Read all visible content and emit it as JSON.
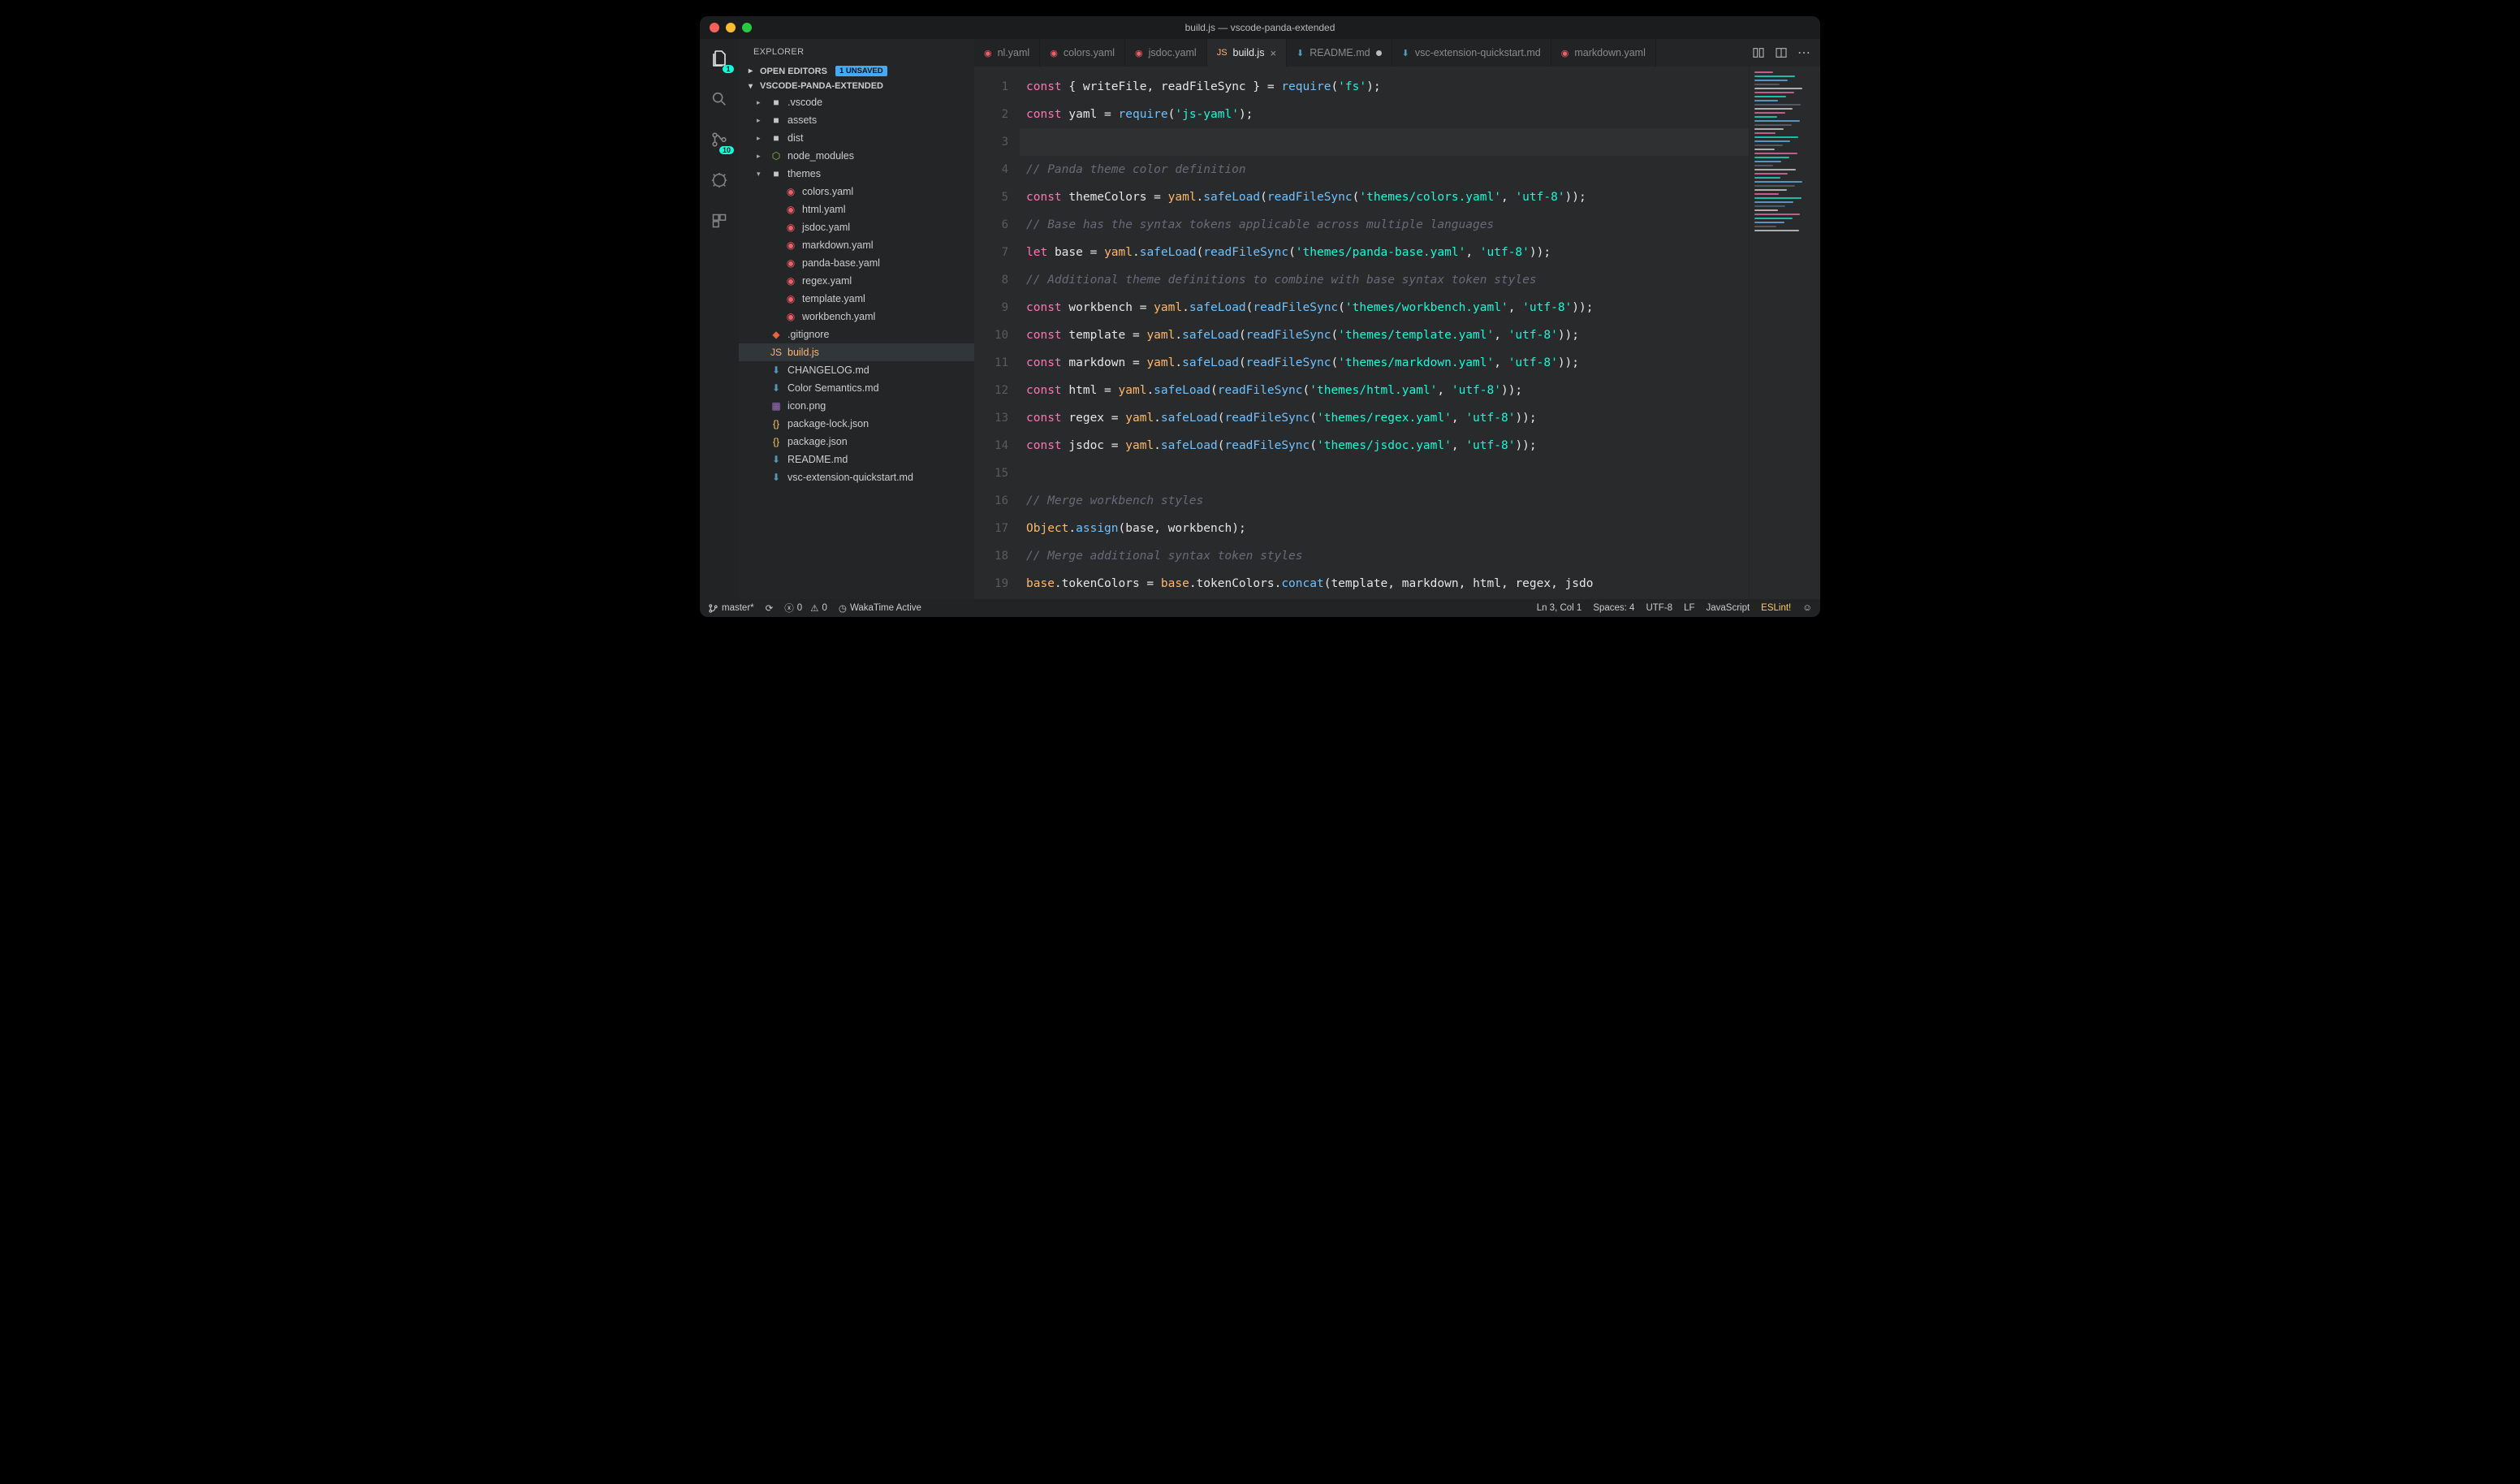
{
  "title": "build.js — vscode-panda-extended",
  "sidebar": {
    "title": "EXPLORER",
    "openEditors": {
      "label": "OPEN EDITORS",
      "badge": "1 UNSAVED"
    },
    "project": "VSCODE-PANDA-EXTENDED",
    "tree": [
      {
        "type": "folder",
        "name": ".vscode",
        "icon": "folder",
        "depth": 1,
        "expanded": false
      },
      {
        "type": "folder",
        "name": "assets",
        "icon": "folder",
        "depth": 1,
        "expanded": false
      },
      {
        "type": "folder",
        "name": "dist",
        "icon": "folder",
        "depth": 1,
        "expanded": false
      },
      {
        "type": "folder",
        "name": "node_modules",
        "icon": "node",
        "depth": 1,
        "expanded": false
      },
      {
        "type": "folder",
        "name": "themes",
        "icon": "folder",
        "depth": 1,
        "expanded": true
      },
      {
        "type": "file",
        "name": "colors.yaml",
        "icon": "y",
        "depth": 2
      },
      {
        "type": "file",
        "name": "html.yaml",
        "icon": "y",
        "depth": 2
      },
      {
        "type": "file",
        "name": "jsdoc.yaml",
        "icon": "y",
        "depth": 2
      },
      {
        "type": "file",
        "name": "markdown.yaml",
        "icon": "y",
        "depth": 2
      },
      {
        "type": "file",
        "name": "panda-base.yaml",
        "icon": "y",
        "depth": 2
      },
      {
        "type": "file",
        "name": "regex.yaml",
        "icon": "y",
        "depth": 2
      },
      {
        "type": "file",
        "name": "template.yaml",
        "icon": "y",
        "depth": 2
      },
      {
        "type": "file",
        "name": "workbench.yaml",
        "icon": "y",
        "depth": 2
      },
      {
        "type": "file",
        "name": ".gitignore",
        "icon": "git",
        "depth": 1
      },
      {
        "type": "file",
        "name": "build.js",
        "icon": "js",
        "depth": 1,
        "selected": true
      },
      {
        "type": "file",
        "name": "CHANGELOG.md",
        "icon": "md",
        "depth": 1
      },
      {
        "type": "file",
        "name": "Color Semantics.md",
        "icon": "md",
        "depth": 1
      },
      {
        "type": "file",
        "name": "icon.png",
        "icon": "img",
        "depth": 1
      },
      {
        "type": "file",
        "name": "package-lock.json",
        "icon": "json",
        "depth": 1
      },
      {
        "type": "file",
        "name": "package.json",
        "icon": "json",
        "depth": 1
      },
      {
        "type": "file",
        "name": "README.md",
        "icon": "md",
        "depth": 1
      },
      {
        "type": "file",
        "name": "vsc-extension-quickstart.md",
        "icon": "md",
        "depth": 1
      }
    ]
  },
  "activityBadges": {
    "explorer": "1",
    "scm": "10"
  },
  "tabs": [
    {
      "label": "nl.yaml",
      "icon": "y",
      "active": false
    },
    {
      "label": "colors.yaml",
      "icon": "y",
      "active": false
    },
    {
      "label": "jsdoc.yaml",
      "icon": "y",
      "active": false
    },
    {
      "label": "build.js",
      "icon": "js",
      "active": true,
      "close": true
    },
    {
      "label": "README.md",
      "icon": "md",
      "active": false,
      "dirty": true
    },
    {
      "label": "vsc-extension-quickstart.md",
      "icon": "md",
      "active": false
    },
    {
      "label": "markdown.yaml",
      "icon": "y",
      "active": false
    }
  ],
  "code": {
    "lines": [
      {
        "n": 1,
        "tokens": [
          [
            "kw",
            "const"
          ],
          [
            "punc",
            " { "
          ],
          [
            "var",
            "writeFile"
          ],
          [
            "punc",
            ", "
          ],
          [
            "var",
            "readFileSync"
          ],
          [
            "punc",
            " } = "
          ],
          [
            "fn",
            "require"
          ],
          [
            "punc",
            "("
          ],
          [
            "str",
            "'fs'"
          ],
          [
            "punc",
            ");"
          ]
        ]
      },
      {
        "n": 2,
        "tokens": [
          [
            "kw",
            "const"
          ],
          [
            "punc",
            " "
          ],
          [
            "var",
            "yaml"
          ],
          [
            "punc",
            " = "
          ],
          [
            "fn",
            "require"
          ],
          [
            "punc",
            "("
          ],
          [
            "str",
            "'js-yaml'"
          ],
          [
            "punc",
            ");"
          ]
        ]
      },
      {
        "n": 3,
        "hl": true,
        "tokens": []
      },
      {
        "n": 4,
        "tokens": [
          [
            "com",
            "// Panda theme color definition"
          ]
        ]
      },
      {
        "n": 5,
        "tokens": [
          [
            "kw",
            "const"
          ],
          [
            "punc",
            " "
          ],
          [
            "var",
            "themeColors"
          ],
          [
            "punc",
            " = "
          ],
          [
            "obj",
            "yaml"
          ],
          [
            "dot",
            "."
          ],
          [
            "fn",
            "safeLoad"
          ],
          [
            "punc",
            "("
          ],
          [
            "fn",
            "readFileSync"
          ],
          [
            "punc",
            "("
          ],
          [
            "str",
            "'themes/colors.yaml'"
          ],
          [
            "punc",
            ", "
          ],
          [
            "str",
            "'utf-8'"
          ],
          [
            "punc",
            "));"
          ]
        ]
      },
      {
        "n": 6,
        "tokens": [
          [
            "com",
            "// Base has the syntax tokens applicable across multiple languages"
          ]
        ]
      },
      {
        "n": 7,
        "tokens": [
          [
            "kw",
            "let"
          ],
          [
            "punc",
            " "
          ],
          [
            "var",
            "base"
          ],
          [
            "punc",
            " = "
          ],
          [
            "obj",
            "yaml"
          ],
          [
            "dot",
            "."
          ],
          [
            "fn",
            "safeLoad"
          ],
          [
            "punc",
            "("
          ],
          [
            "fn",
            "readFileSync"
          ],
          [
            "punc",
            "("
          ],
          [
            "str",
            "'themes/panda-base.yaml'"
          ],
          [
            "punc",
            ", "
          ],
          [
            "str",
            "'utf-8'"
          ],
          [
            "punc",
            "));"
          ]
        ]
      },
      {
        "n": 8,
        "tokens": [
          [
            "com",
            "// Additional theme definitions to combine with base syntax token styles"
          ]
        ]
      },
      {
        "n": 9,
        "tokens": [
          [
            "kw",
            "const"
          ],
          [
            "punc",
            " "
          ],
          [
            "var",
            "workbench"
          ],
          [
            "punc",
            " = "
          ],
          [
            "obj",
            "yaml"
          ],
          [
            "dot",
            "."
          ],
          [
            "fn",
            "safeLoad"
          ],
          [
            "punc",
            "("
          ],
          [
            "fn",
            "readFileSync"
          ],
          [
            "punc",
            "("
          ],
          [
            "str",
            "'themes/workbench.yaml'"
          ],
          [
            "punc",
            ", "
          ],
          [
            "str",
            "'utf-8'"
          ],
          [
            "punc",
            "));"
          ]
        ]
      },
      {
        "n": 10,
        "tokens": [
          [
            "kw",
            "const"
          ],
          [
            "punc",
            " "
          ],
          [
            "var",
            "template"
          ],
          [
            "punc",
            " = "
          ],
          [
            "obj",
            "yaml"
          ],
          [
            "dot",
            "."
          ],
          [
            "fn",
            "safeLoad"
          ],
          [
            "punc",
            "("
          ],
          [
            "fn",
            "readFileSync"
          ],
          [
            "punc",
            "("
          ],
          [
            "str",
            "'themes/template.yaml'"
          ],
          [
            "punc",
            ", "
          ],
          [
            "str",
            "'utf-8'"
          ],
          [
            "punc",
            "));"
          ]
        ]
      },
      {
        "n": 11,
        "tokens": [
          [
            "kw",
            "const"
          ],
          [
            "punc",
            " "
          ],
          [
            "var",
            "markdown"
          ],
          [
            "punc",
            " = "
          ],
          [
            "obj",
            "yaml"
          ],
          [
            "dot",
            "."
          ],
          [
            "fn",
            "safeLoad"
          ],
          [
            "punc",
            "("
          ],
          [
            "fn",
            "readFileSync"
          ],
          [
            "punc",
            "("
          ],
          [
            "str",
            "'themes/markdown.yaml'"
          ],
          [
            "punc",
            ", "
          ],
          [
            "str",
            "'utf-8'"
          ],
          [
            "punc",
            "));"
          ]
        ]
      },
      {
        "n": 12,
        "mark": "green",
        "tokens": [
          [
            "kw",
            "const"
          ],
          [
            "punc",
            " "
          ],
          [
            "var",
            "html"
          ],
          [
            "punc",
            " = "
          ],
          [
            "obj",
            "yaml"
          ],
          [
            "dot",
            "."
          ],
          [
            "fn",
            "safeLoad"
          ],
          [
            "punc",
            "("
          ],
          [
            "fn",
            "readFileSync"
          ],
          [
            "punc",
            "("
          ],
          [
            "str",
            "'themes/html.yaml'"
          ],
          [
            "punc",
            ", "
          ],
          [
            "str",
            "'utf-8'"
          ],
          [
            "punc",
            "));"
          ]
        ]
      },
      {
        "n": 13,
        "tokens": [
          [
            "kw",
            "const"
          ],
          [
            "punc",
            " "
          ],
          [
            "var",
            "regex"
          ],
          [
            "punc",
            " = "
          ],
          [
            "obj",
            "yaml"
          ],
          [
            "dot",
            "."
          ],
          [
            "fn",
            "safeLoad"
          ],
          [
            "punc",
            "("
          ],
          [
            "fn",
            "readFileSync"
          ],
          [
            "punc",
            "("
          ],
          [
            "str",
            "'themes/regex.yaml'"
          ],
          [
            "punc",
            ", "
          ],
          [
            "str",
            "'utf-8'"
          ],
          [
            "punc",
            "));"
          ]
        ]
      },
      {
        "n": 14,
        "tokens": [
          [
            "kw",
            "const"
          ],
          [
            "punc",
            " "
          ],
          [
            "var",
            "jsdoc"
          ],
          [
            "punc",
            " = "
          ],
          [
            "obj",
            "yaml"
          ],
          [
            "dot",
            "."
          ],
          [
            "fn",
            "safeLoad"
          ],
          [
            "punc",
            "("
          ],
          [
            "fn",
            "readFileSync"
          ],
          [
            "punc",
            "("
          ],
          [
            "str",
            "'themes/jsdoc.yaml'"
          ],
          [
            "punc",
            ", "
          ],
          [
            "str",
            "'utf-8'"
          ],
          [
            "punc",
            "));"
          ]
        ]
      },
      {
        "n": 15,
        "tokens": []
      },
      {
        "n": 16,
        "tokens": [
          [
            "com",
            "// Merge workbench styles"
          ]
        ]
      },
      {
        "n": 17,
        "tokens": [
          [
            "obj",
            "Object"
          ],
          [
            "dot",
            "."
          ],
          [
            "fn",
            "assign"
          ],
          [
            "punc",
            "("
          ],
          [
            "var",
            "base"
          ],
          [
            "punc",
            ", "
          ],
          [
            "var",
            "workbench"
          ],
          [
            "punc",
            ");"
          ]
        ]
      },
      {
        "n": 18,
        "tokens": [
          [
            "com",
            "// Merge additional syntax token styles"
          ]
        ]
      },
      {
        "n": 19,
        "mark": "orange",
        "tokens": [
          [
            "obj",
            "base"
          ],
          [
            "dot",
            "."
          ],
          [
            "var",
            "tokenColors"
          ],
          [
            "punc",
            " = "
          ],
          [
            "obj",
            "base"
          ],
          [
            "dot",
            "."
          ],
          [
            "var",
            "tokenColors"
          ],
          [
            "dot",
            "."
          ],
          [
            "fn",
            "concat"
          ],
          [
            "punc",
            "("
          ],
          [
            "var",
            "template"
          ],
          [
            "punc",
            ", "
          ],
          [
            "var",
            "markdown"
          ],
          [
            "punc",
            ", "
          ],
          [
            "var",
            "html"
          ],
          [
            "punc",
            ", "
          ],
          [
            "var",
            "regex"
          ],
          [
            "punc",
            ", "
          ],
          [
            "var",
            "jsdo"
          ]
        ]
      }
    ]
  },
  "statusbar": {
    "branch": "master*",
    "sync": "⟳",
    "errors": "0",
    "warnings": "0",
    "wakatime": "WakaTime Active",
    "cursor": "Ln 3, Col 1",
    "spaces": "Spaces: 4",
    "encoding": "UTF-8",
    "eol": "LF",
    "language": "JavaScript",
    "eslint": "ESLint!",
    "smiley": "☺"
  }
}
